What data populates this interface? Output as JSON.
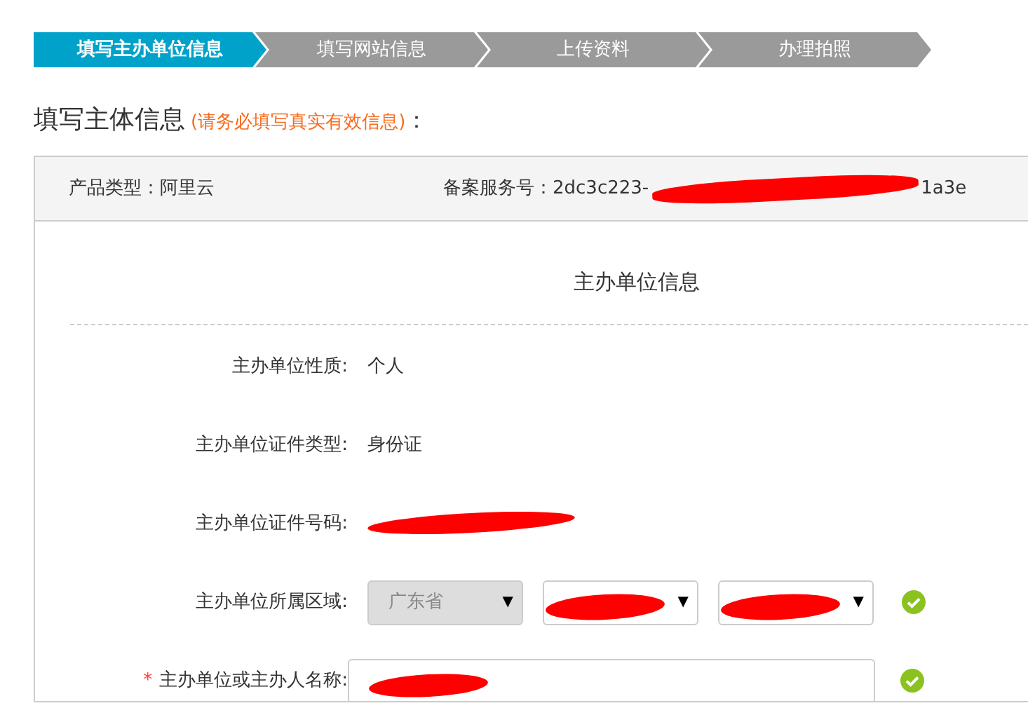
{
  "steps": [
    {
      "label": "填写主办单位信息",
      "selected": true
    },
    {
      "label": "填写网站信息",
      "selected": false
    },
    {
      "label": "上传资料",
      "selected": false
    },
    {
      "label": "办理拍照",
      "selected": false
    }
  ],
  "heading": {
    "title": "填写主体信息",
    "note": "(请务必填写真实有效信息)",
    "colon": "："
  },
  "info": {
    "product_label": "产品类型：",
    "product": "阿里云",
    "service_label": "备案服务号：",
    "service_start": "2dc3c223-",
    "service_end": "1a3e"
  },
  "section_title": "主办单位信息",
  "caret": "▼",
  "required_mark": "*",
  "fields": [
    {
      "kind": "text",
      "label": "主办单位性质:",
      "value": "个人",
      "required": false,
      "valid": false
    },
    {
      "kind": "text",
      "label": "主办单位证件类型:",
      "value": "身份证",
      "required": false,
      "valid": false
    },
    {
      "kind": "redacted",
      "label": "主办单位证件号码:",
      "required": false,
      "valid": false
    },
    {
      "kind": "selects",
      "label": "主办单位所属区域:",
      "required": false,
      "valid": true,
      "selects": [
        {
          "value": "广东省",
          "disabled": true,
          "redacted": false
        },
        {
          "disabled": false,
          "redacted": true
        },
        {
          "disabled": false,
          "redacted": true
        }
      ]
    },
    {
      "kind": "input",
      "label": "主办单位或主办人名称:",
      "required": true,
      "valid": true,
      "redacted": true
    }
  ]
}
